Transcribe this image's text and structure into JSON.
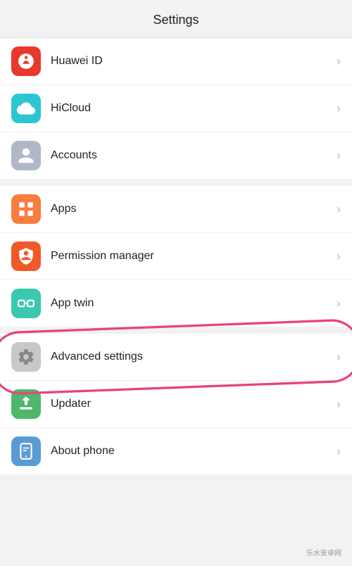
{
  "header": {
    "title": "Settings"
  },
  "sections": [
    {
      "id": "accounts-section",
      "items": [
        {
          "id": "huawei-id",
          "label": "Huawei ID",
          "icon": "huawei",
          "iconColor": "#e8392d"
        },
        {
          "id": "hicloud",
          "label": "HiCloud",
          "icon": "hicloud",
          "iconColor": "#2bc5d4"
        },
        {
          "id": "accounts",
          "label": "Accounts",
          "icon": "accounts",
          "iconColor": "#b0b8c8"
        }
      ]
    },
    {
      "id": "apps-section",
      "items": [
        {
          "id": "apps",
          "label": "Apps",
          "icon": "apps",
          "iconColor": "#f87d3e"
        },
        {
          "id": "permission-manager",
          "label": "Permission manager",
          "icon": "permission",
          "iconColor": "#f05a28"
        },
        {
          "id": "app-twin",
          "label": "App twin",
          "icon": "apptwin",
          "iconColor": "#3bc8b0"
        }
      ]
    },
    {
      "id": "advanced-section",
      "items": [
        {
          "id": "advanced-settings",
          "label": "Advanced settings",
          "icon": "advanced",
          "iconColor": "#c8c8c8",
          "highlighted": true
        },
        {
          "id": "updater",
          "label": "Updater",
          "icon": "updater",
          "iconColor": "#4db86a"
        },
        {
          "id": "about-phone",
          "label": "About phone",
          "icon": "aboutphone",
          "iconColor": "#5b9bd5"
        }
      ]
    }
  ],
  "chevron": "›",
  "watermark_text": "乐水安卓网"
}
